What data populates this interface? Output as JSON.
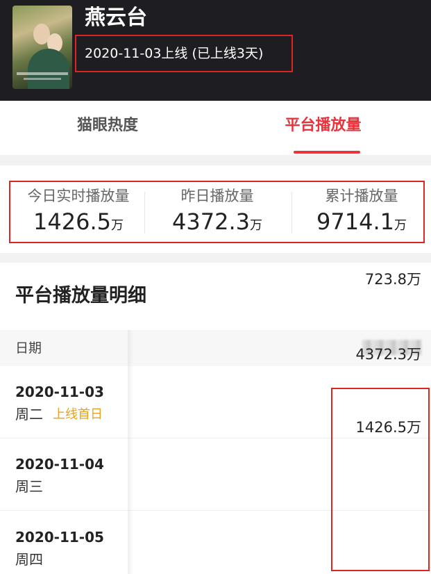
{
  "show": {
    "title": "燕云台",
    "release": "2020-11-03上线 (已上线3天)"
  },
  "tabs": [
    {
      "label": "猫眼热度",
      "active": false
    },
    {
      "label": "平台播放量",
      "active": true
    }
  ],
  "stats": [
    {
      "label": "今日实时播放量",
      "value": "1426.5",
      "unit": "万"
    },
    {
      "label": "昨日播放量",
      "value": "4372.3",
      "unit": "万"
    },
    {
      "label": "累计播放量",
      "value": "9714.1",
      "unit": "万"
    }
  ],
  "detail": {
    "title": "平台播放量明细",
    "date_header": "日期",
    "rows": [
      {
        "date": "2020-11-03",
        "weekday": "周二",
        "tag": "上线首日",
        "value": "723.8万"
      },
      {
        "date": "2020-11-04",
        "weekday": "周三",
        "tag": "",
        "value": "4372.3万"
      },
      {
        "date": "2020-11-05",
        "weekday": "周四",
        "tag": "",
        "value": "1426.5万"
      }
    ]
  },
  "colors": {
    "accent": "#e8343c",
    "highlight_box": "#e02424",
    "tag": "#e8a21a",
    "header_bg": "#1e1e22"
  }
}
